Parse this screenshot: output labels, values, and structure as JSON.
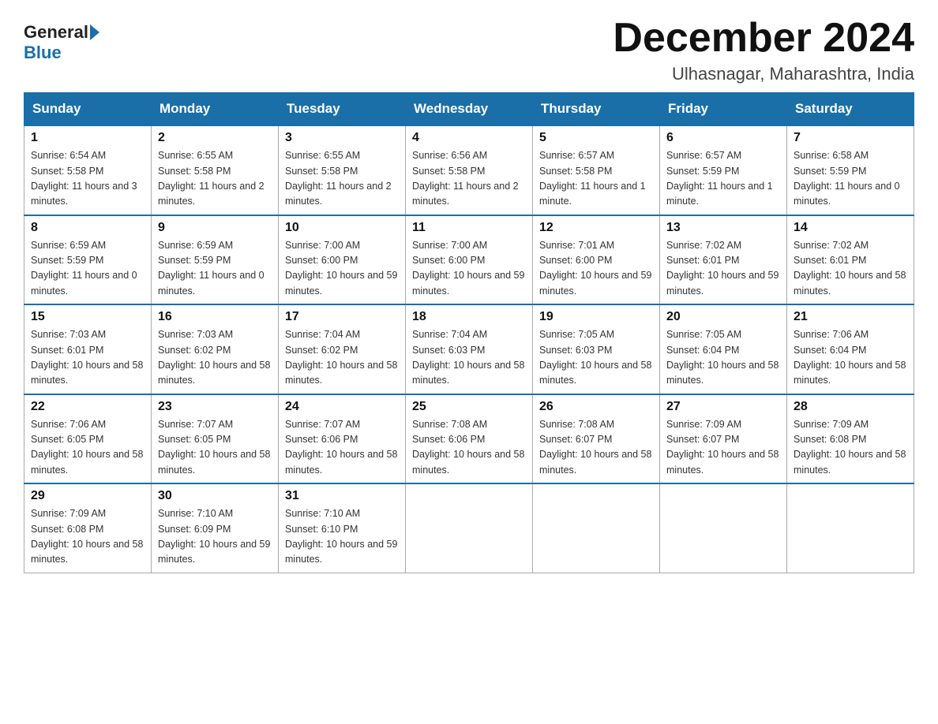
{
  "logo": {
    "general": "General",
    "blue": "Blue"
  },
  "title": "December 2024",
  "subtitle": "Ulhasnagar, Maharashtra, India",
  "days_of_week": [
    "Sunday",
    "Monday",
    "Tuesday",
    "Wednesday",
    "Thursday",
    "Friday",
    "Saturday"
  ],
  "weeks": [
    [
      {
        "day": "1",
        "sunrise": "6:54 AM",
        "sunset": "5:58 PM",
        "daylight": "11 hours and 3 minutes."
      },
      {
        "day": "2",
        "sunrise": "6:55 AM",
        "sunset": "5:58 PM",
        "daylight": "11 hours and 2 minutes."
      },
      {
        "day": "3",
        "sunrise": "6:55 AM",
        "sunset": "5:58 PM",
        "daylight": "11 hours and 2 minutes."
      },
      {
        "day": "4",
        "sunrise": "6:56 AM",
        "sunset": "5:58 PM",
        "daylight": "11 hours and 2 minutes."
      },
      {
        "day": "5",
        "sunrise": "6:57 AM",
        "sunset": "5:58 PM",
        "daylight": "11 hours and 1 minute."
      },
      {
        "day": "6",
        "sunrise": "6:57 AM",
        "sunset": "5:59 PM",
        "daylight": "11 hours and 1 minute."
      },
      {
        "day": "7",
        "sunrise": "6:58 AM",
        "sunset": "5:59 PM",
        "daylight": "11 hours and 0 minutes."
      }
    ],
    [
      {
        "day": "8",
        "sunrise": "6:59 AM",
        "sunset": "5:59 PM",
        "daylight": "11 hours and 0 minutes."
      },
      {
        "day": "9",
        "sunrise": "6:59 AM",
        "sunset": "5:59 PM",
        "daylight": "11 hours and 0 minutes."
      },
      {
        "day": "10",
        "sunrise": "7:00 AM",
        "sunset": "6:00 PM",
        "daylight": "10 hours and 59 minutes."
      },
      {
        "day": "11",
        "sunrise": "7:00 AM",
        "sunset": "6:00 PM",
        "daylight": "10 hours and 59 minutes."
      },
      {
        "day": "12",
        "sunrise": "7:01 AM",
        "sunset": "6:00 PM",
        "daylight": "10 hours and 59 minutes."
      },
      {
        "day": "13",
        "sunrise": "7:02 AM",
        "sunset": "6:01 PM",
        "daylight": "10 hours and 59 minutes."
      },
      {
        "day": "14",
        "sunrise": "7:02 AM",
        "sunset": "6:01 PM",
        "daylight": "10 hours and 58 minutes."
      }
    ],
    [
      {
        "day": "15",
        "sunrise": "7:03 AM",
        "sunset": "6:01 PM",
        "daylight": "10 hours and 58 minutes."
      },
      {
        "day": "16",
        "sunrise": "7:03 AM",
        "sunset": "6:02 PM",
        "daylight": "10 hours and 58 minutes."
      },
      {
        "day": "17",
        "sunrise": "7:04 AM",
        "sunset": "6:02 PM",
        "daylight": "10 hours and 58 minutes."
      },
      {
        "day": "18",
        "sunrise": "7:04 AM",
        "sunset": "6:03 PM",
        "daylight": "10 hours and 58 minutes."
      },
      {
        "day": "19",
        "sunrise": "7:05 AM",
        "sunset": "6:03 PM",
        "daylight": "10 hours and 58 minutes."
      },
      {
        "day": "20",
        "sunrise": "7:05 AM",
        "sunset": "6:04 PM",
        "daylight": "10 hours and 58 minutes."
      },
      {
        "day": "21",
        "sunrise": "7:06 AM",
        "sunset": "6:04 PM",
        "daylight": "10 hours and 58 minutes."
      }
    ],
    [
      {
        "day": "22",
        "sunrise": "7:06 AM",
        "sunset": "6:05 PM",
        "daylight": "10 hours and 58 minutes."
      },
      {
        "day": "23",
        "sunrise": "7:07 AM",
        "sunset": "6:05 PM",
        "daylight": "10 hours and 58 minutes."
      },
      {
        "day": "24",
        "sunrise": "7:07 AM",
        "sunset": "6:06 PM",
        "daylight": "10 hours and 58 minutes."
      },
      {
        "day": "25",
        "sunrise": "7:08 AM",
        "sunset": "6:06 PM",
        "daylight": "10 hours and 58 minutes."
      },
      {
        "day": "26",
        "sunrise": "7:08 AM",
        "sunset": "6:07 PM",
        "daylight": "10 hours and 58 minutes."
      },
      {
        "day": "27",
        "sunrise": "7:09 AM",
        "sunset": "6:07 PM",
        "daylight": "10 hours and 58 minutes."
      },
      {
        "day": "28",
        "sunrise": "7:09 AM",
        "sunset": "6:08 PM",
        "daylight": "10 hours and 58 minutes."
      }
    ],
    [
      {
        "day": "29",
        "sunrise": "7:09 AM",
        "sunset": "6:08 PM",
        "daylight": "10 hours and 58 minutes."
      },
      {
        "day": "30",
        "sunrise": "7:10 AM",
        "sunset": "6:09 PM",
        "daylight": "10 hours and 59 minutes."
      },
      {
        "day": "31",
        "sunrise": "7:10 AM",
        "sunset": "6:10 PM",
        "daylight": "10 hours and 59 minutes."
      },
      null,
      null,
      null,
      null
    ]
  ]
}
